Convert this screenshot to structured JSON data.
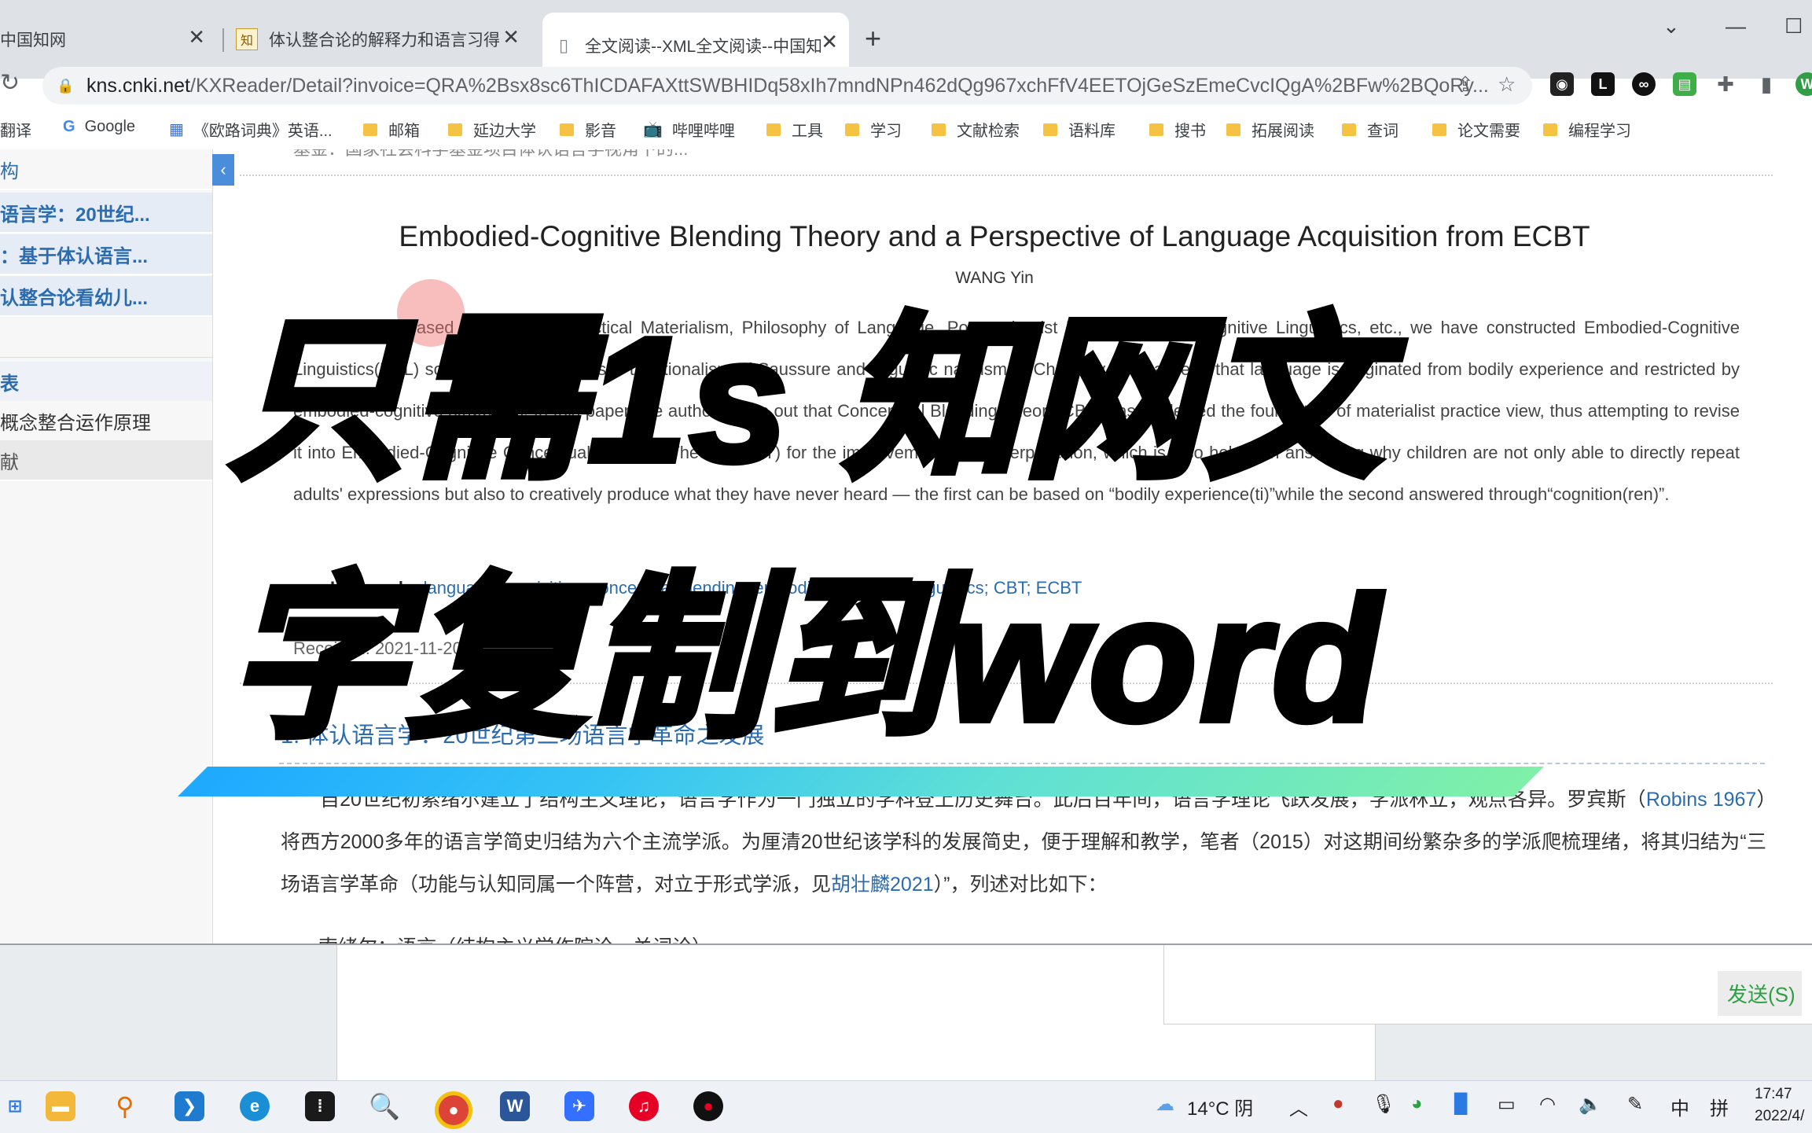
{
  "browser": {
    "tabs": [
      {
        "title": "中国知网",
        "icon": "cnki-icon"
      },
      {
        "title": "体认整合论的解释力和语言习得",
        "icon": "zhi-icon"
      },
      {
        "title": "全文阅读--XML全文阅读--中国知",
        "icon": "doc-icon"
      }
    ],
    "new_tab": "+",
    "window_controls": [
      "⌄",
      "—",
      "☐"
    ],
    "url_host": "kns.cnki.net",
    "url_path": "/KXReader/Detail?invoice=QRA%2Bsx8sc6ThICDAFAXttSWBHIDq58xIh7mndNPn462dQg967xchFfV4EETOjGeSzEmeCvcIQgA%2BFw%2BQoRy...",
    "bookmarks": [
      "翻译",
      "Google",
      "《欧路词典》英语...",
      "邮箱",
      "延边大学",
      "影音",
      "哔哩哔哩",
      "工具",
      "学习",
      "文献检索",
      "语料库",
      "搜书",
      "拓展阅读",
      "查词",
      "论文需要",
      "编程学习"
    ]
  },
  "sidebar": {
    "items": [
      {
        "label": "构"
      },
      {
        "label": "语言学：20世纪..."
      },
      {
        "label": "：基于体认语言..."
      },
      {
        "label": "认整合论看幼儿..."
      },
      {
        "label": ""
      },
      {
        "label": "表"
      },
      {
        "label": "概念整合运作原理"
      },
      {
        "label": "献"
      }
    ],
    "collapse": "‹"
  },
  "article": {
    "top_cut": "基金：国家社会科学基金项目体认语言学视角下的...",
    "title": "Embodied-Cognitive Blending Theory and a Perspective of Language Acquisition from ECBT",
    "author": "WANG Yin",
    "abstract_label": "Abstract:",
    "abstract": "Based on Marxist Dialectical Materialism, Philosophy of Language, Postmodernist Philosophy and Cognitive Linguistics, etc., we have constructed Embodied-Cognitive Linguistics(ECL) so as to criticize linguistic traditionalism of Saussure and linguistic nativism of Chomsky. ECL asserts that language is originated from bodily experience and restricted by embodied-cognitive strategies. In this paper, the author points out that Conceptual Blending Theory(CBT) has neglected the foundation of materialist practice view, thus attempting to revise it into Embodied-Cognitive Conceptual Blending Theory(ECBT) for the improvement of its interpretation, which is also helpful in answering why children are not only able to directly repeat adults' expressions but also to creatively produce what they have never heard — the first can be based on “bodily experience(ti)”while the second answered through“cognition(ren)”.",
    "keywords_label": "Keywords:",
    "keywords": "language acquisition; conceptual blending; embodied-cognitive linguistics; CBT; ECBT",
    "received": "Received: 2021-11-20",
    "section_title": "1. 体认语言学：20世纪第三场语言学革命之发展",
    "para_1": "自20世纪初索绪尔建立了结构主义理论，语言学作为一门独立的学科登上历史舞台。此后百年间，语言学理论飞跃发展，学派林立，观点各异。罗宾斯（",
    "para_link_1": "Robins 1967",
    "para_2": "）将西方2000多年的语言学简史归结为六个主流学派。为厘清20世纪该学科的发展简史，便于理解和教学，笔者（2015）对这期间纷繁杂多的学派爬梳理绪，将其归结为“三场语言学革命（功能与认知同属一个阵营，对立于形式学派，见",
    "para_link_2": "胡壮麟2021",
    "para_3": "）”，列述对比如下：",
    "next_line_cut": "索绪尔：语言（结构主义学作院论、关词论）"
  },
  "overlay": {
    "line1": "只需1s 知网文",
    "line2": "字复制到word"
  },
  "desktop": {
    "send_button": "发送(S)"
  },
  "taskbar": {
    "weather": "14°C 阴",
    "ime_lang": "中",
    "ime_mode": "拼",
    "time": "17:47",
    "date": "2022/4/"
  },
  "colors": {
    "link": "#2b6cb0",
    "banner_start": "#1fa9ff",
    "banner_end": "#7ff0a8",
    "send": "#2ea043"
  }
}
